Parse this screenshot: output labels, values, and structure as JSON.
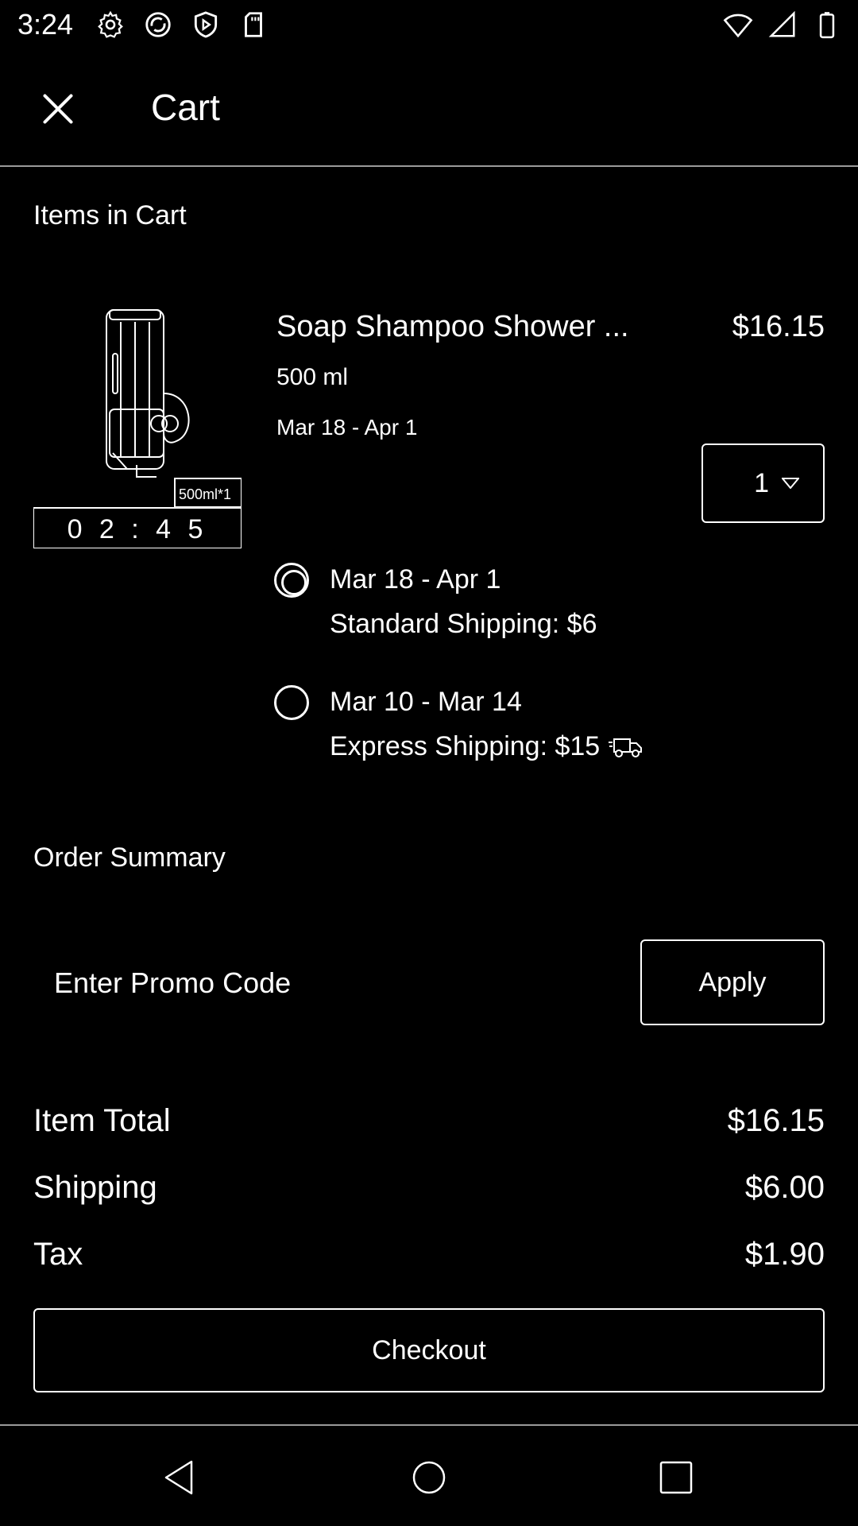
{
  "status_bar": {
    "time": "3:24",
    "left_icons": [
      "gear-icon",
      "sync-icon",
      "play-shield-icon",
      "sd-card-icon"
    ],
    "right_icons": [
      "wifi-icon",
      "cell-signal-icon",
      "battery-icon"
    ]
  },
  "app_bar": {
    "close_icon": "close-icon",
    "title": "Cart"
  },
  "items_section": {
    "title": "Items in Cart"
  },
  "product": {
    "image_badge": "500ml*1",
    "image_timer": "0 2 : 4 5",
    "name": "Soap Shampoo Shower ...",
    "price": "$16.15",
    "size": "500 ml",
    "dates": "Mar 18 - Apr 1",
    "quantity": "1"
  },
  "shipping_options": [
    {
      "date": "Mar 18 - Apr 1",
      "description": "Standard Shipping: $6",
      "selected": true,
      "icon": ""
    },
    {
      "date": "Mar 10 - Mar 14",
      "description": "Express Shipping: $15",
      "selected": false,
      "icon": "truck-icon"
    }
  ],
  "summary": {
    "title": "Order Summary",
    "promo_placeholder": "Enter Promo Code",
    "apply_label": "Apply",
    "item_total_label": "Item Total",
    "item_total_value": "$16.15",
    "shipping_label": "Shipping",
    "shipping_value": "$6.00",
    "tax_label": "Tax",
    "tax_value": "$1.90"
  },
  "checkout": {
    "label": "Checkout"
  },
  "nav_bar": {
    "buttons": [
      "back-icon",
      "home-icon",
      "recents-icon"
    ]
  },
  "colors": {
    "background": "#000000",
    "foreground": "#ffffff",
    "divider": "#9a9a9a"
  }
}
